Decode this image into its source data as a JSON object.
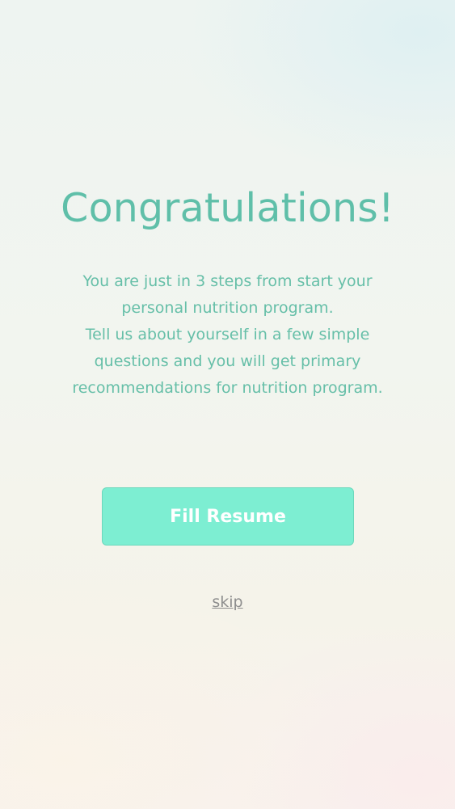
{
  "onboarding": {
    "title": "Congratulations!",
    "description_lines": [
      "You are just in 3 steps from start your personal nutrition program.",
      "Tell us about yourself in a few simple questions and you will get primary recommendations for nutrition program."
    ],
    "primary_button_label": "Fill Resume",
    "skip_label": "skip"
  },
  "colors": {
    "accent_text": "#5fbfa9",
    "button_fill": "#7deed2",
    "button_text": "#ffffff",
    "skip_link": "#8e8e8e"
  }
}
